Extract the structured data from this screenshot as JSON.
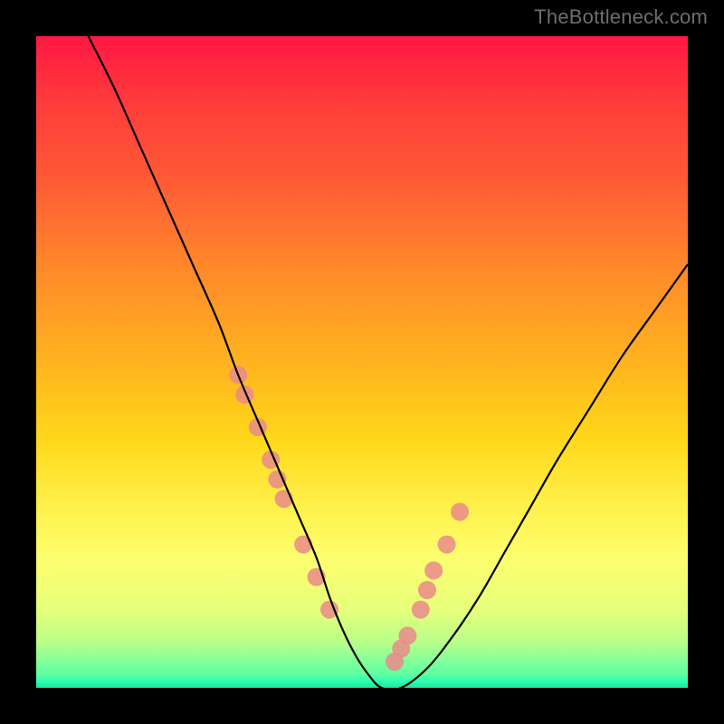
{
  "watermark": "TheBottleneck.com",
  "chart_data": {
    "type": "line",
    "title": "",
    "xlabel": "",
    "ylabel": "",
    "ylim": [
      0,
      100
    ],
    "xlim": [
      0,
      100
    ],
    "series": [
      {
        "name": "bottleneck-curve",
        "x": [
          8,
          12,
          16,
          20,
          24,
          28,
          31,
          34,
          37,
          40,
          43,
          45,
          47,
          49,
          51,
          53,
          56,
          60,
          64,
          68,
          72,
          76,
          80,
          85,
          90,
          95,
          100
        ],
        "values": [
          100,
          92,
          83,
          74,
          65,
          56,
          48,
          41,
          34,
          27,
          20,
          14,
          9,
          5,
          2,
          0,
          0,
          3,
          8,
          14,
          21,
          28,
          35,
          43,
          51,
          58,
          65
        ]
      }
    ],
    "markers": {
      "name": "highlighted-points",
      "x": [
        31,
        32,
        34,
        36,
        37,
        38,
        41,
        43,
        45,
        55,
        56,
        57,
        59,
        60,
        61,
        63,
        65
      ],
      "values": [
        48,
        45,
        40,
        35,
        32,
        29,
        22,
        17,
        12,
        4,
        6,
        8,
        12,
        15,
        18,
        22,
        27
      ]
    },
    "marker_style": {
      "color": "#e98989",
      "radius": 10
    },
    "curve_style": {
      "color": "#000000",
      "width": 2.2
    }
  }
}
